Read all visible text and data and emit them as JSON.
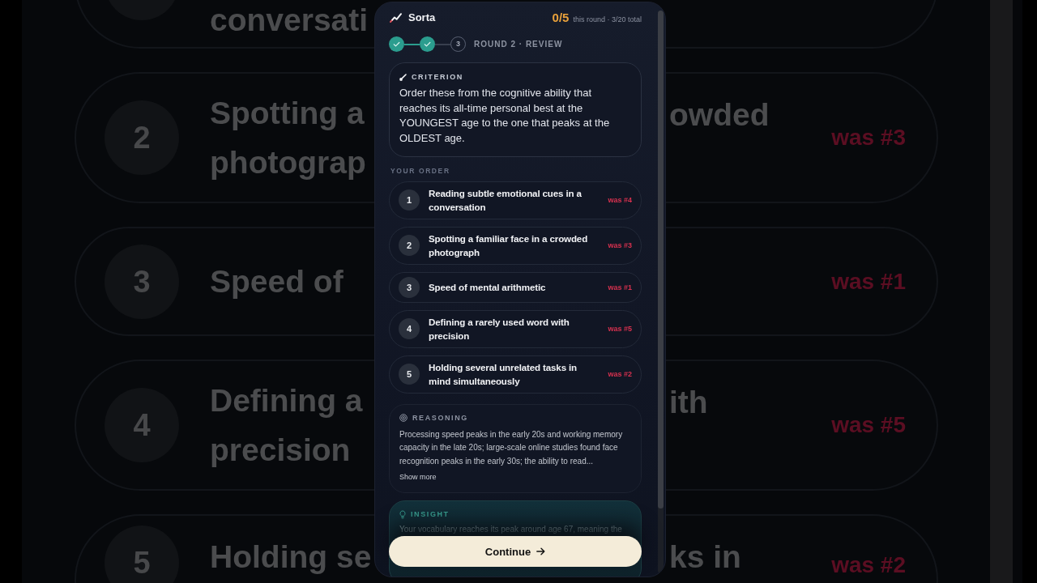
{
  "backdrop": {
    "rows": [
      {
        "text_left": [
          "conversati"
        ]
      },
      {
        "number": "2",
        "text_left": [
          "Spotting a",
          "photograp"
        ],
        "text_right": [
          "owded"
        ],
        "was": "was #3",
        "correct": false
      },
      {
        "number": "3",
        "text_left": [
          "Speed of"
        ],
        "was": "was #1",
        "correct": false
      },
      {
        "number": "4",
        "text_left": [
          "Defining a",
          "precision"
        ],
        "text_right": [
          "ith"
        ],
        "was": "was #5",
        "correct": false
      },
      {
        "number": "5",
        "text_left": [
          "Holding se"
        ],
        "text_right": [
          "ks in"
        ],
        "was": "was #2",
        "correct": false
      }
    ]
  },
  "header": {
    "app_name": "Sorta",
    "score": "0/5",
    "score_note": "this round · 3/20 total"
  },
  "stepper": {
    "steps": [
      {
        "done": true
      },
      {
        "done": true
      },
      {
        "done": false,
        "label": "3"
      }
    ],
    "stage": "ROUND 2 · REVIEW"
  },
  "criterion": {
    "label": "CRITERION",
    "text": "Order these from the cognitive ability that reaches its all-time personal best at the YOUNGEST age to the one that peaks at the OLDEST age."
  },
  "order": {
    "label": "YOUR ORDER",
    "items": [
      {
        "number": "1",
        "text": "Reading subtle emotional cues in a conversation",
        "was": "was #4",
        "correct": false
      },
      {
        "number": "2",
        "text": "Spotting a familiar face in a crowded photograph",
        "was": "was #3",
        "correct": false
      },
      {
        "number": "3",
        "text": "Speed of mental arithmetic",
        "was": "was #1",
        "correct": false
      },
      {
        "number": "4",
        "text": "Defining a rarely used word with precision",
        "was": "was #5",
        "correct": false
      },
      {
        "number": "5",
        "text": "Holding several unrelated tasks in mind simultaneously",
        "was": "was #2",
        "correct": false
      }
    ]
  },
  "reasoning": {
    "label": "REASONING",
    "text": "Processing speed peaks in the early 20s and working memory capacity in the late 20s; large-scale online studies found face recognition peaks in the early 30s; the ability to read...",
    "link": "Show more"
  },
  "insight": {
    "label": "INSIGHT",
    "text": "Your vocabulary reaches its peak around age 67, meaning the"
  },
  "continue_button": {
    "label": "Continue"
  }
}
